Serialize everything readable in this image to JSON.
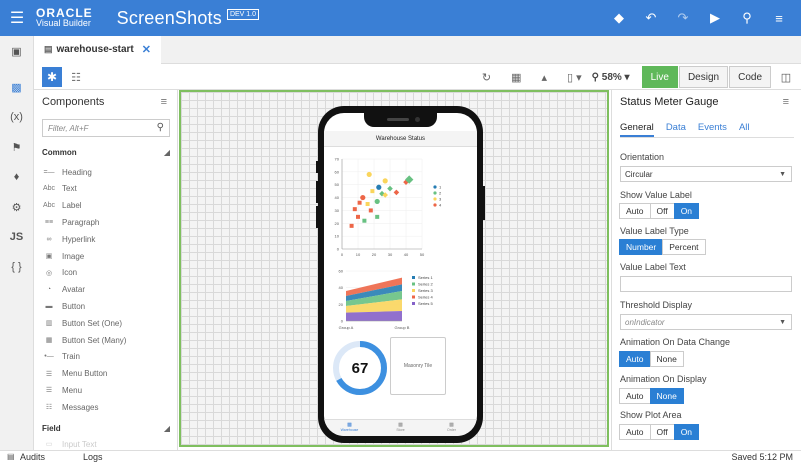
{
  "header": {
    "brand_top": "ORACLE",
    "brand_bottom": "Visual Builder",
    "app_name": "ScreenShots",
    "badge": "DEV 1.0",
    "accent": "#3a7fd5"
  },
  "tab": {
    "label": "warehouse-start"
  },
  "toolbar": {
    "zoom": "58%",
    "modes": [
      "Live",
      "Design",
      "Code"
    ],
    "live_color": "#5fb85a"
  },
  "components": {
    "title": "Components",
    "filter_placeholder": "Filter, Alt+F",
    "common_label": "Common",
    "items": [
      "Heading",
      "Text",
      "Label",
      "Paragraph",
      "Hyperlink",
      "Image",
      "Icon",
      "Avatar",
      "Button",
      "Button Set (One)",
      "Button Set (Many)",
      "Train",
      "Menu Button",
      "Menu",
      "Messages"
    ],
    "field_label": "Field",
    "field_item": "Input Text"
  },
  "phone": {
    "app_title": "Warehouse Status",
    "scatter": {
      "legend": [
        "1",
        "2",
        "3",
        "4"
      ],
      "x_ticks": [
        "0",
        "10",
        "20",
        "30",
        "40",
        "50"
      ],
      "y_ticks": [
        "0",
        "10",
        "20",
        "30",
        "40",
        "50",
        "60",
        "70"
      ],
      "colors": [
        "#267db3",
        "#68c182",
        "#fad55c",
        "#ed6647"
      ]
    },
    "area": {
      "legend": [
        "Series 1",
        "Series 2",
        "Series 3",
        "Series 4",
        "Series 5"
      ],
      "y_ticks": [
        "0",
        "20",
        "40",
        "60"
      ],
      "x_ticks": [
        "Group A",
        "Group B"
      ],
      "colors": [
        "#267db3",
        "#68c182",
        "#fad55c",
        "#ed6647",
        "#8561c8"
      ]
    },
    "gauge": {
      "value": "67",
      "fraction": 0.67
    },
    "masonry_label": "Masonry Tile",
    "nav": [
      "Warehouse",
      "Store",
      "Order"
    ]
  },
  "properties": {
    "title": "Status Meter Gauge",
    "tabs": [
      "General",
      "Data",
      "Events",
      "All"
    ],
    "orientation_label": "Orientation",
    "orientation_value": "Circular",
    "show_value_label": "Show Value Label",
    "show_value_opts": [
      "Auto",
      "Off",
      "On"
    ],
    "value_type_label": "Value Label Type",
    "value_type_opts": [
      "Number",
      "Percent"
    ],
    "value_text_label": "Value Label Text",
    "threshold_label": "Threshold Display",
    "threshold_placeholder": "onIndicator",
    "anim_change_label": "Animation On Data Change",
    "anim_change_opts": [
      "Auto",
      "None"
    ],
    "anim_display_label": "Animation On Display",
    "anim_display_opts": [
      "Auto",
      "None"
    ],
    "plot_area_label": "Show Plot Area",
    "plot_area_opts": [
      "Auto",
      "Off",
      "On"
    ]
  },
  "status": {
    "audits": "Audits",
    "logs": "Logs",
    "saved": "Saved 5:12 PM"
  }
}
